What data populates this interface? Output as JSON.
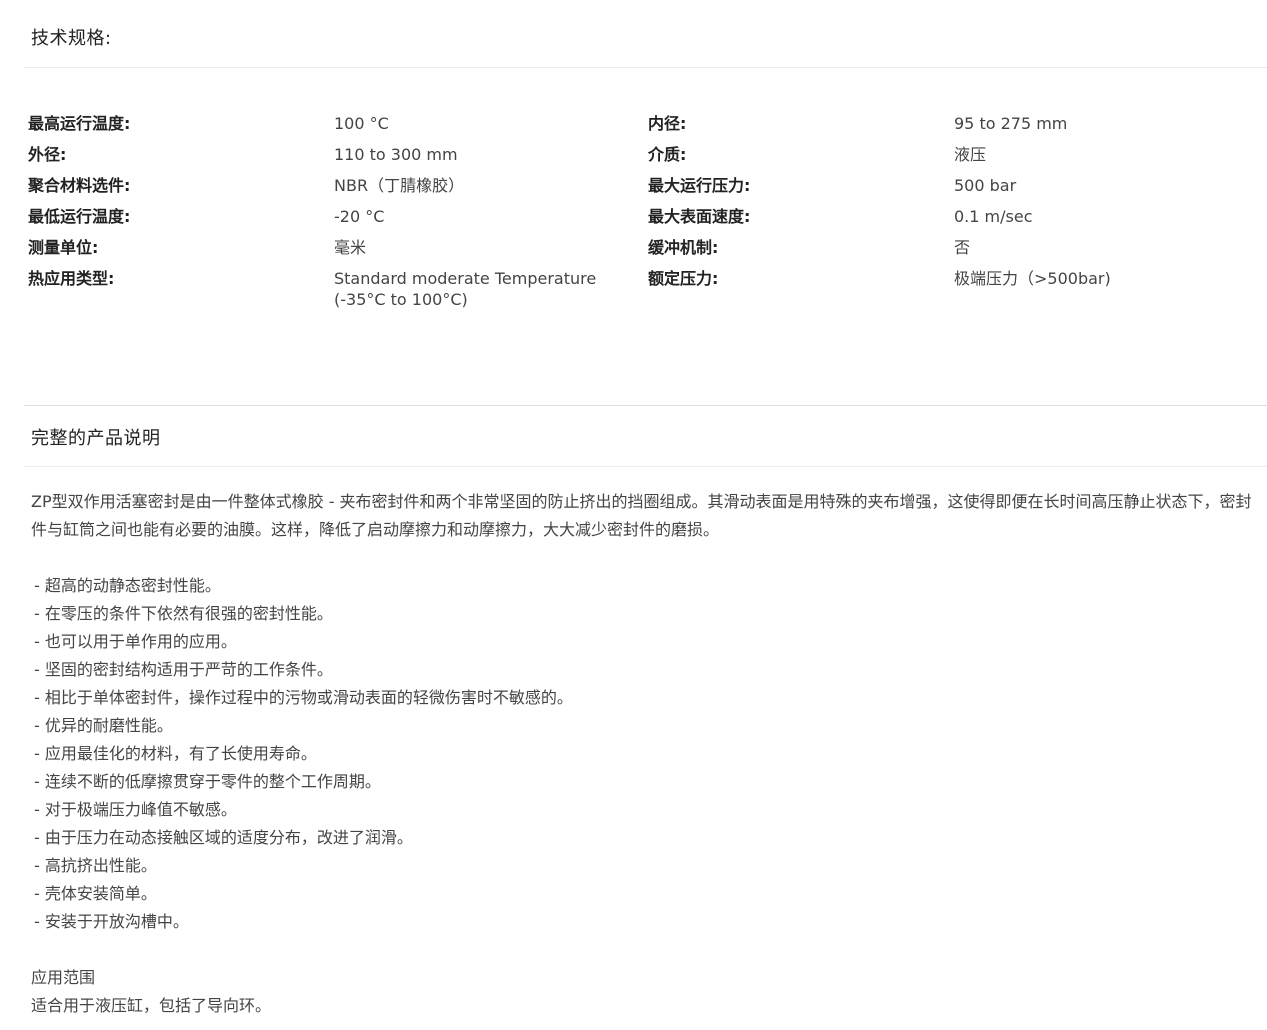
{
  "specs_section": {
    "title": "技术规格:",
    "rows": [
      {
        "label": "最高运行温度:",
        "value": "100 °C",
        "label2": "内径:",
        "value2": "95 to 275 mm"
      },
      {
        "label": "外径:",
        "value": "110 to 300 mm",
        "label2": "介质:",
        "value2": "液压"
      },
      {
        "label": "聚合材料选件:",
        "value": "NBR（丁腈橡胶）",
        "label2": "最大运行压力:",
        "value2": "500 bar"
      },
      {
        "label": "最低运行温度:",
        "value": "-20 °C",
        "label2": "最大表面速度:",
        "value2": "0.1 m/sec"
      },
      {
        "label": "测量单位:",
        "value": "毫米",
        "label2": "缓冲机制:",
        "value2": "否"
      },
      {
        "label": "热应用类型:",
        "value": "Standard moderate Temperature\n(-35°C to 100°C)",
        "label2": "额定压力:",
        "value2": "极端压力（>500bar)"
      }
    ]
  },
  "description_section": {
    "title": "完整的产品说明",
    "intro": "ZP型双作用活塞密封是由一件整体式橡胶 - 夹布密封件和两个非常坚固的防止挤出的挡圈组成。其滑动表面是用特殊的夹布增强，这使得即便在长时间高压静止状态下，密封件与缸筒之间也能有必要的油膜。这样，降低了启动摩擦力和动摩擦力，大大减少密封件的磨损。",
    "features": [
      "- 超高的动静态密封性能。",
      "- 在零压的条件下依然有很强的密封性能。",
      "- 也可以用于单作用的应用。",
      "- 坚固的密封结构适用于严苛的工作条件。",
      "- 相比于单体密封件，操作过程中的污物或滑动表面的轻微伤害时不敏感的。",
      "- 优异的耐磨性能。",
      "- 应用最佳化的材料，有了长使用寿命。",
      "- 连续不断的低摩擦贯穿于零件的整个工作周期。",
      "- 对于极端压力峰值不敏感。",
      "- 由于压力在动态接触区域的适度分布，改进了润滑。",
      "- 高抗挤出性能。",
      "- 壳体安装简单。",
      "- 安装于开放沟槽中。"
    ],
    "applications_title": "应用范围",
    "applications_text": "适合用于液压缸，包括了导向环。"
  }
}
